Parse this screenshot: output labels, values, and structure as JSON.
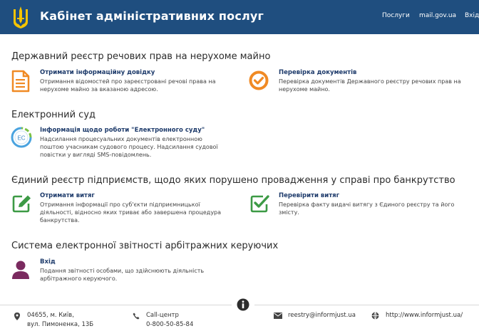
{
  "header": {
    "title": "Кабінет адміністративних послуг",
    "nav": [
      "Послуги",
      "mail.gov.ua",
      "Вхід"
    ]
  },
  "sections": [
    {
      "title": "Державний реєстр речових прав на нерухоме майно",
      "cards": [
        {
          "icon": "document-icon",
          "title": "Отримати інформаційну довідку",
          "desc": "Отримання відомостей про зареєстровані речові права на нерухоме майно за вказаною адресою."
        },
        {
          "icon": "check-circle-icon",
          "title": "Перевірка документів",
          "desc": "Перевірка документів Державного реєстру речових прав на нерухоме майно."
        }
      ]
    },
    {
      "title": "Електронний суд",
      "cards": [
        {
          "icon": "ec-logo-icon",
          "title": "Інформація щодо роботи \"Електронного суду\"",
          "desc": "Надсилання процесуальних документів електронною поштою учасникам судового процесу. Надсилання судової повістки у вигляді SMS-повідомлень.",
          "logo_text": "EC"
        }
      ]
    },
    {
      "title": "Єдиний реєстр підприємств, щодо яких порушено провадження у справі про банкрутство",
      "cards": [
        {
          "icon": "edit-icon",
          "title": "Отримати витяг",
          "desc": "Отримання інформації про суб'єкти підприємницької діяльності, відносно яких триває або завершена процедура банкрутства."
        },
        {
          "icon": "checkbox-icon",
          "title": "Перевірити витяг",
          "desc": "Перевірка факту видачі витягу з Єдиного реєстру та його змісту."
        }
      ]
    },
    {
      "title": "Система електронної звітності арбітражних керуючих",
      "cards": [
        {
          "icon": "user-icon",
          "title": "Вхід",
          "desc": "Подання звітності особами, що здійснюють діяльність арбітражного керуючого."
        }
      ]
    }
  ],
  "footer": {
    "address_line1": "04655, м. Київ,",
    "address_line2": "вул. Пимоненка, 13Б",
    "phone_label": "Call-центр",
    "phone": "0-800-50-85-84",
    "email": "reestry@informjust.ua",
    "website": "http://www.informjust.ua/"
  },
  "colors": {
    "header_bg": "#1f4e7f",
    "orange": "#f08a24",
    "green": "#3c9a45",
    "purple": "#7a2a5f"
  }
}
